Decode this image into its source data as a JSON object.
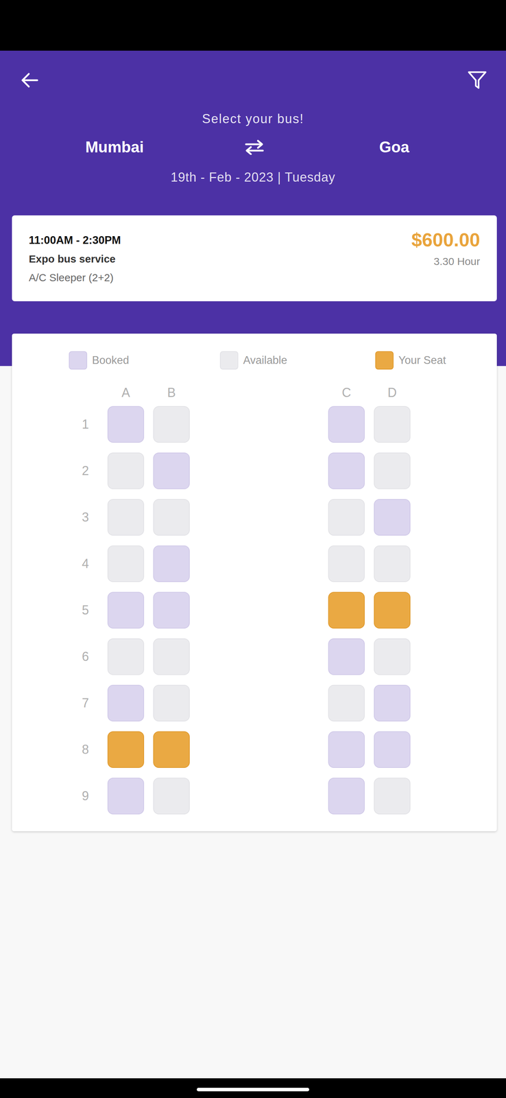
{
  "header": {
    "title": "Select your bus!",
    "from": "Mumbai",
    "to": "Goa",
    "date": "19th - Feb - 2023 | Tuesday"
  },
  "bus": {
    "time": "11:00AM - 2:30PM",
    "operator": "Expo bus service",
    "type": "A/C Sleeper (2+2)",
    "price": "$600.00",
    "duration": "3.30 Hour"
  },
  "legend": [
    {
      "label": "Booked",
      "kind": "booked"
    },
    {
      "label": "Available",
      "kind": "available"
    },
    {
      "label": "Your Seat",
      "kind": "selected"
    }
  ],
  "columns": [
    "A",
    "B",
    "C",
    "D"
  ],
  "rows": [
    {
      "number": "1",
      "seats": [
        {
          "kind": "booked"
        },
        {
          "kind": "available"
        },
        {
          "kind": "booked"
        },
        {
          "kind": "available"
        }
      ]
    },
    {
      "number": "2",
      "seats": [
        {
          "kind": "available"
        },
        {
          "kind": "booked"
        },
        {
          "kind": "booked"
        },
        {
          "kind": "available"
        }
      ]
    },
    {
      "number": "3",
      "seats": [
        {
          "kind": "available"
        },
        {
          "kind": "available"
        },
        {
          "kind": "available"
        },
        {
          "kind": "booked"
        }
      ]
    },
    {
      "number": "4",
      "seats": [
        {
          "kind": "available"
        },
        {
          "kind": "booked"
        },
        {
          "kind": "available"
        },
        {
          "kind": "available"
        }
      ]
    },
    {
      "number": "5",
      "seats": [
        {
          "kind": "booked"
        },
        {
          "kind": "booked"
        },
        {
          "kind": "selected"
        },
        {
          "kind": "selected"
        }
      ]
    },
    {
      "number": "6",
      "seats": [
        {
          "kind": "available"
        },
        {
          "kind": "available"
        },
        {
          "kind": "booked"
        },
        {
          "kind": "available"
        }
      ]
    },
    {
      "number": "7",
      "seats": [
        {
          "kind": "booked"
        },
        {
          "kind": "available"
        },
        {
          "kind": "available"
        },
        {
          "kind": "booked"
        }
      ]
    },
    {
      "number": "8",
      "seats": [
        {
          "kind": "selected"
        },
        {
          "kind": "selected"
        },
        {
          "kind": "booked"
        },
        {
          "kind": "booked"
        }
      ]
    },
    {
      "number": "9",
      "seats": [
        {
          "kind": "booked"
        },
        {
          "kind": "available"
        },
        {
          "kind": "booked"
        },
        {
          "kind": "available"
        }
      ]
    }
  ]
}
